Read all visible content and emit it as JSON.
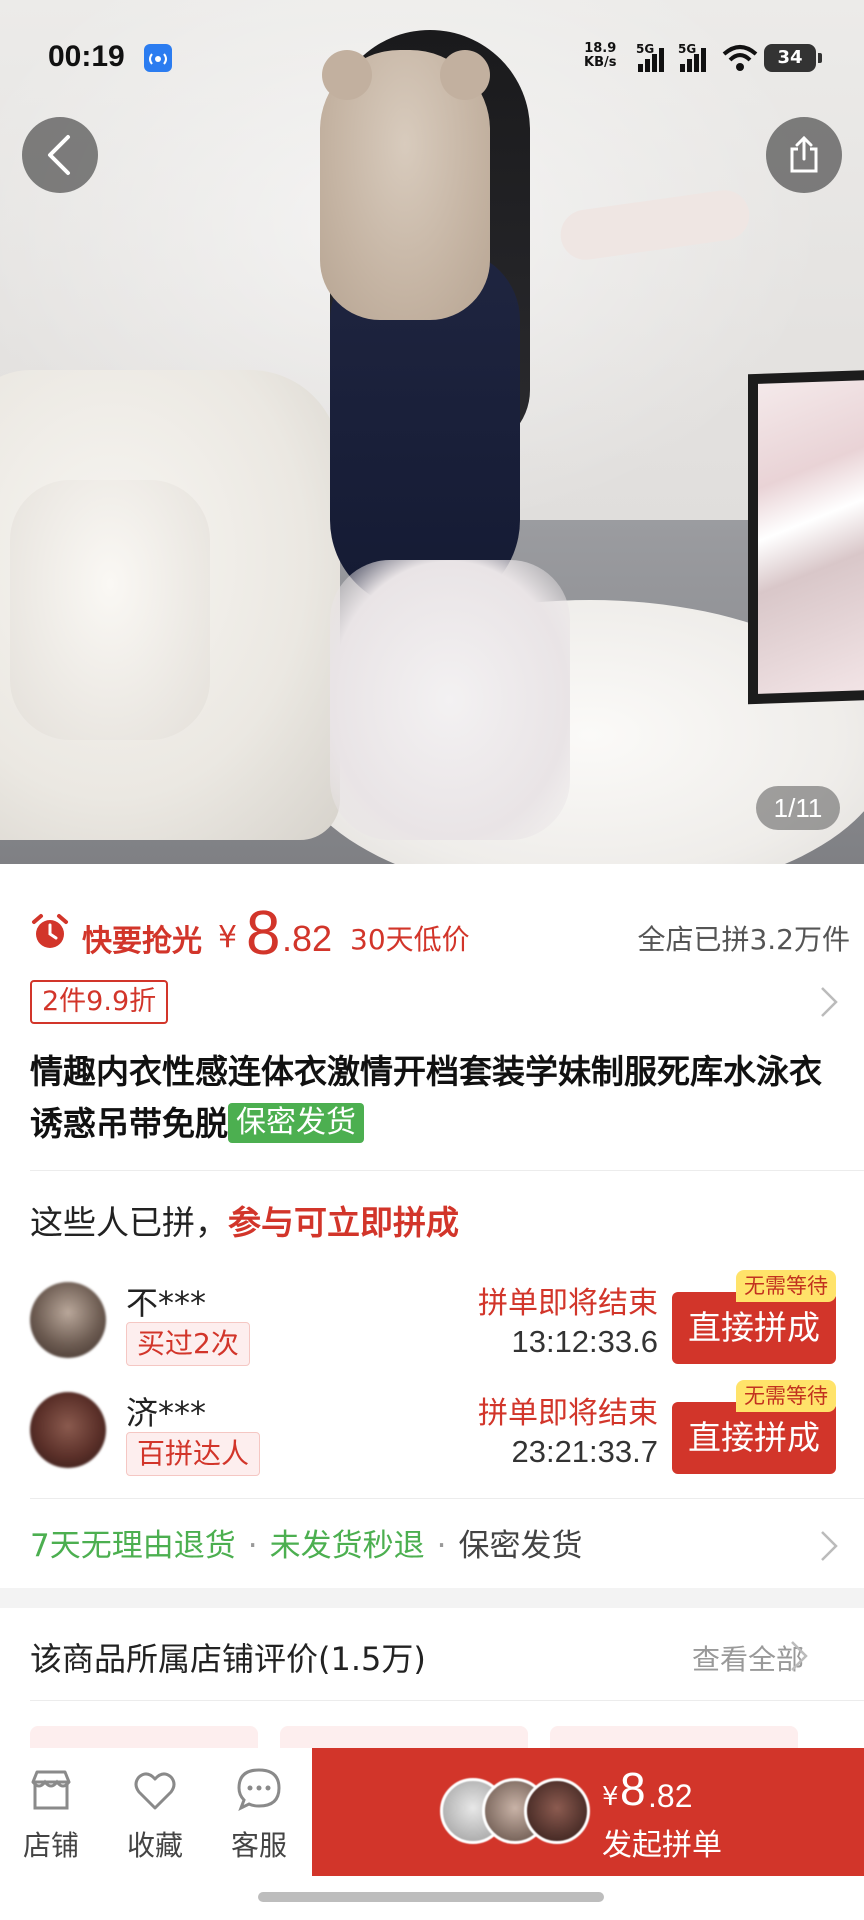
{
  "status_bar": {
    "time": "00:19",
    "net_speed_value": "18.9",
    "net_speed_unit": "KB/s",
    "signal1_label": "5G",
    "signal2_label": "5G",
    "battery": "34"
  },
  "gallery": {
    "counter": "1/11"
  },
  "price": {
    "rush_label": "快要抢光",
    "currency": "¥",
    "integer": "8",
    "decimal": ".82",
    "low_price_tag": "30天低价",
    "sold_count": "全店已拼3.2万件"
  },
  "coupon": {
    "label": "2件9.9折"
  },
  "product": {
    "title": "情趣内衣性感连体衣激情开档套装学妹制服死库水泳衣诱惑吊带免脱",
    "secret_tag": "保密发货"
  },
  "group_buy": {
    "header_prefix": "这些人已拼，",
    "header_highlight": "参与可立即拼成",
    "groups": [
      {
        "name": "不***",
        "badge": "买过2次",
        "ending_label": "拼单即将结束",
        "timer": "13:12:33.6",
        "join_label": "直接拼成",
        "no_wait": "无需等待"
      },
      {
        "name": "济***",
        "badge": "百拼达人",
        "ending_label": "拼单即将结束",
        "timer": "23:21:33.7",
        "join_label": "直接拼成",
        "no_wait": "无需等待"
      }
    ]
  },
  "guarantees": {
    "items": [
      "7天无理由退货",
      "未发货秒退",
      "保密发货"
    ],
    "separator": "·"
  },
  "reviews": {
    "title": "该商品所属店铺评价(1.5万)",
    "view_all": "查看全部"
  },
  "bottom_bar": {
    "store": "店铺",
    "favorite": "收藏",
    "service": "客服",
    "buy_currency": "¥",
    "buy_integer": "8",
    "buy_decimal": ".82",
    "buy_label": "发起拼单"
  },
  "colors": {
    "accent_red": "#d2352a",
    "green": "#4caf50",
    "no_wait_yellow": "#ffe36a"
  }
}
